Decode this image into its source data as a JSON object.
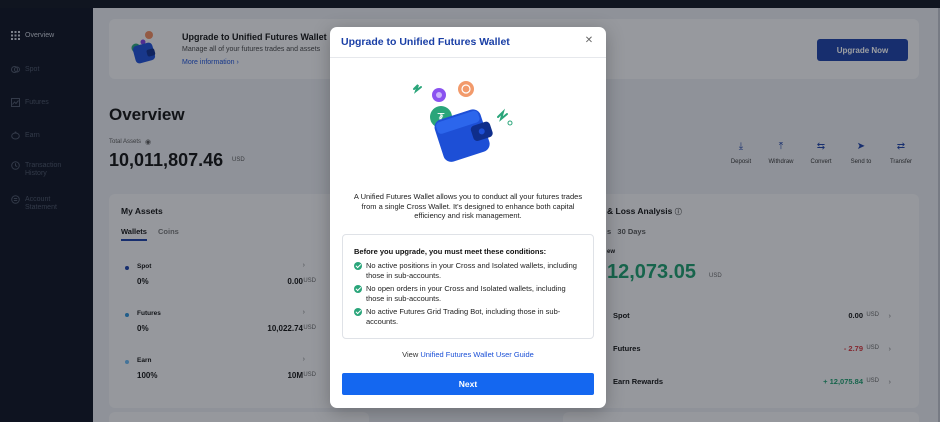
{
  "sidebar": {
    "items": [
      {
        "label": "Overview",
        "icon": "grid-icon"
      },
      {
        "label": "Spot",
        "icon": "coins-icon"
      },
      {
        "label": "Futures",
        "icon": "chart-icon"
      },
      {
        "label": "Earn",
        "icon": "piggy-icon"
      },
      {
        "label": "Transaction History",
        "icon": "clock-icon"
      },
      {
        "label": "Account Statement",
        "icon": "document-icon"
      }
    ]
  },
  "banner": {
    "title": "Upgrade to Unified Futures Wallet",
    "subtitle": "Manage all of your futures trades and assets",
    "more": "More information",
    "cta": "Upgrade Now"
  },
  "overview": {
    "title": "Overview",
    "total_label": "Total Assets",
    "total_value": "10,011,807.46",
    "total_ccy": "USD",
    "actions": [
      "Deposit",
      "Withdraw",
      "Convert",
      "Send to",
      "Transfer"
    ]
  },
  "assets": {
    "title": "My Assets",
    "tabs": [
      "Wallets",
      "Coins"
    ],
    "rows": [
      {
        "name": "Spot",
        "pct": "0%",
        "amount": "0.00",
        "ccy": "USD",
        "color": "#1a3fa6"
      },
      {
        "name": "Futures",
        "pct": "0%",
        "amount": "10,022.74",
        "ccy": "USD",
        "color": "#2c8fd6"
      },
      {
        "name": "Earn",
        "pct": "100%",
        "amount": "10M",
        "ccy": "USD",
        "color": "#69b7f0"
      }
    ]
  },
  "pnl": {
    "title": "& Loss Analysis",
    "tabs": "s   30 Days",
    "small": "ew",
    "big": "12,073.05",
    "big_ccy": "USD",
    "rows": [
      {
        "label": "Spot",
        "value": "0.00",
        "ccy": "USD",
        "color": "#111111"
      },
      {
        "label": "Futures",
        "value": "- 2.79",
        "ccy": "USD",
        "color": "#d6333a"
      },
      {
        "label": "Earn Rewards",
        "value": "+ 12,075.84",
        "ccy": "USD",
        "color": "#1a9c6b"
      }
    ]
  },
  "modal": {
    "title": "Upgrade to Unified Futures Wallet",
    "description": "A Unified Futures Wallet allows you to conduct all your futures trades from a single Cross Wallet. It's designed to enhance both capital efficiency and risk management.",
    "conditions_title": "Before you upgrade, you must meet these conditions:",
    "conditions": [
      "No active positions in your Cross and Isolated wallets, including those in sub-accounts.",
      "No open orders in your Cross and Isolated wallets, including those in sub-accounts.",
      "No active Futures Grid Trading Bot, including those in sub-accounts."
    ],
    "guide_prefix": "View",
    "guide_link": "Unified Futures Wallet User Guide",
    "next": "Next"
  }
}
